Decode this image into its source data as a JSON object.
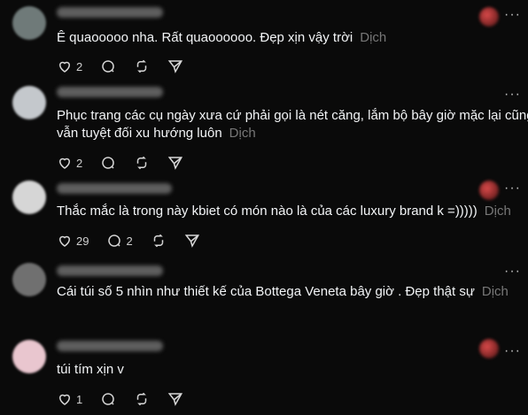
{
  "translate_label": "Dịch",
  "comments": [
    {
      "text_lines": [
        "Ê quaooooo nha. Rất quaoooooo. Đẹp xịn vậy trời"
      ],
      "likes": "2",
      "replies": "",
      "avatar_color": "#6f7a79"
    },
    {
      "text_lines": [
        "Phục trang các cụ ngày xưa cứ phải gọi là nét căng, lắm bộ bây giờ mặc lại cũng",
        "vẫn tuyệt đối xu hướng luôn"
      ],
      "likes": "2",
      "replies": "",
      "avatar_color": "#c4c8cc"
    },
    {
      "text_lines": [
        "Thắc mắc là trong này kbiet có món nào là của các luxury brand k =)))))"
      ],
      "likes": "29",
      "replies": "2",
      "avatar_color": "#d6d6d6"
    },
    {
      "text_lines": [
        "Cái túi số 5 nhìn như thiết kế của Bottega Veneta bây giờ . Đẹp thật sự"
      ],
      "likes": "",
      "replies": "",
      "avatar_color": "#707070"
    },
    {
      "text_lines": [
        "túi tím xịn v"
      ],
      "likes": "1",
      "replies": "",
      "avatar_color": "#e9c6cf"
    }
  ]
}
